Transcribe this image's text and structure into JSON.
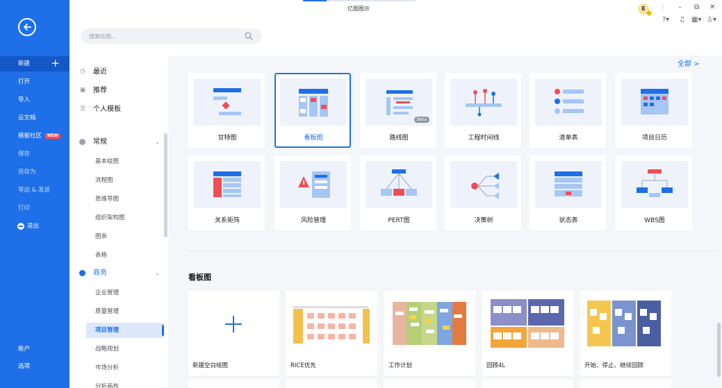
{
  "app": {
    "title": "亿图图示"
  },
  "colors": {
    "accent": "#1e6fe8",
    "nav_bg": "#1e6fe8",
    "badge": "#ff4a4a"
  },
  "leftnav": {
    "items": [
      {
        "label": "新建",
        "icon": "plus-icon"
      },
      {
        "label": "打开"
      },
      {
        "label": "导入"
      },
      {
        "label": "云文档"
      },
      {
        "label": "模板社区",
        "badge": "NEW"
      },
      {
        "label": "保存"
      },
      {
        "label": "另存为"
      },
      {
        "label": "导出 & 发送"
      },
      {
        "label": "打印"
      },
      {
        "label": "退出",
        "icon": "exit-icon"
      }
    ],
    "bottom": [
      {
        "label": "账户"
      },
      {
        "label": "选项"
      }
    ]
  },
  "topbar": {
    "search_placeholder": "搜索绘图...",
    "avatar_letter": "E",
    "icons": [
      "help-icon",
      "bell-icon",
      "apps-icon",
      "shirt-icon"
    ]
  },
  "categories": {
    "top": [
      {
        "label": "最近",
        "icon": "clock-icon"
      },
      {
        "label": "推荐",
        "icon": "star-icon"
      },
      {
        "label": "个人模板",
        "icon": "template-icon"
      }
    ],
    "groups": [
      {
        "label": "常规",
        "items": [
          "基本绘图",
          "流程图",
          "思维导图",
          "组织架构图",
          "图表",
          "表格"
        ]
      },
      {
        "label": "商务",
        "items": [
          "企业管理",
          "质量管理",
          "项目管理",
          "战略规划",
          "市场分析",
          "分析画布"
        ],
        "active": "项目管理"
      }
    ]
  },
  "main": {
    "all_link": "全部 >",
    "templates": [
      {
        "label": "甘特图",
        "icon": "gantt-icon"
      },
      {
        "label": "看板图",
        "icon": "kanban-icon",
        "selected": true
      },
      {
        "label": "路线图",
        "icon": "roadmap-icon",
        "badge": "Beta"
      },
      {
        "label": "工程时间线",
        "icon": "timeline-icon"
      },
      {
        "label": "清单表",
        "icon": "checklist-icon"
      },
      {
        "label": "项目日历",
        "icon": "calendar-icon"
      },
      {
        "label": "关系矩阵",
        "icon": "matrix-icon"
      },
      {
        "label": "风险管理",
        "icon": "risk-icon"
      },
      {
        "label": "PERT图",
        "icon": "pert-icon"
      },
      {
        "label": "决策树",
        "icon": "decision-tree-icon"
      },
      {
        "label": "状态表",
        "icon": "status-table-icon"
      },
      {
        "label": "WBS图",
        "icon": "wbs-icon"
      }
    ],
    "section_title": "看板图",
    "examples": [
      {
        "label": "新建空白绘图"
      },
      {
        "label": "RICE优先"
      },
      {
        "label": "工作计划"
      },
      {
        "label": "回顾4L"
      },
      {
        "label": "开始、停止、继续回顾"
      }
    ]
  }
}
